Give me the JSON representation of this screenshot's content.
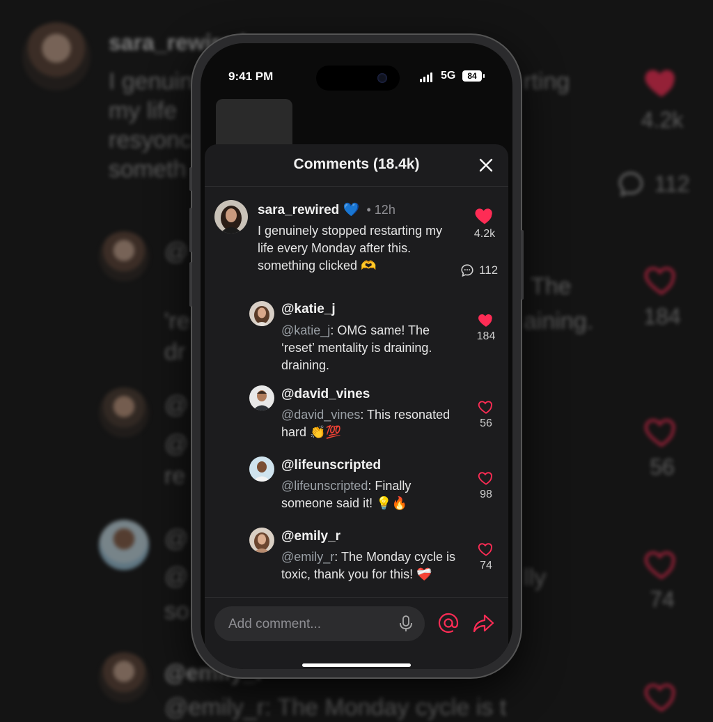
{
  "background": {
    "name": "sara_rewired",
    "comment_fragments": [
      "I genuin",
      "my life",
      "resyonc",
      "someth"
    ],
    "right_fragments": [
      "rting",
      "The",
      "aining.",
      "lly"
    ],
    "mention_rows": [
      "@",
      "'re",
      "dr",
      "@",
      "@",
      "re",
      "@",
      "@",
      "so",
      "@emily_r",
      "@emily_r: The Monday cycle is t"
    ],
    "counts": [
      "4.2k",
      "112",
      "184",
      "56",
      "74"
    ]
  },
  "status_bar": {
    "time": "9:41 PM",
    "network": "5G",
    "battery": "84"
  },
  "sheet": {
    "title": "Comments (18.4k)"
  },
  "comments": {
    "main": {
      "username": "sara_rewired",
      "badge": "💙",
      "time": "12h",
      "text": "I genuinely stopped restarting my life every Monday after this. something clicked 🫶",
      "likes": "4.2k",
      "replies": "112"
    },
    "replies": [
      {
        "username": "@katie_j",
        "mention": "@katie_j",
        "text": ": OMG same! The ‘reset’ mentality is draining. draining.",
        "likes": "184",
        "liked": true
      },
      {
        "username": "@david_vines",
        "mention": "@david_vines",
        "text": ": This resonated hard 👏💯",
        "likes": "56",
        "liked": false
      },
      {
        "username": "@lifeunscripted",
        "mention": "@lifeunscripted",
        "text": ": Finally someone said it! 💡🔥",
        "likes": "98",
        "liked": false
      },
      {
        "username": "@emily_r",
        "mention": "@emily_r",
        "text": ": The Monday cycle is toxic, thank you for this! ❤️‍🩹",
        "likes": "74",
        "liked": false
      }
    ]
  },
  "composer": {
    "placeholder": "Add comment..."
  },
  "colors": {
    "accent": "#fe2c55",
    "sheet": "#1c1c1e",
    "background": "#141414"
  },
  "icons": [
    "heart-icon",
    "reply-bubble-icon",
    "close-icon",
    "mic-icon",
    "at-icon",
    "share-icon"
  ]
}
